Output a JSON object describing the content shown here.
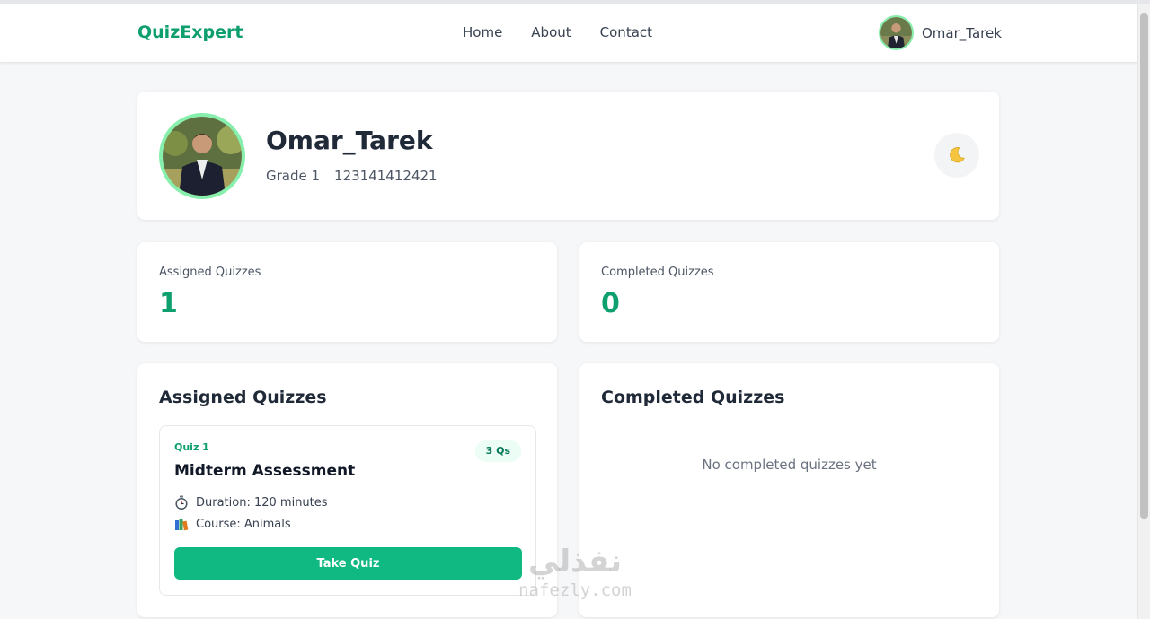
{
  "brand": "QuizExpert",
  "nav": {
    "links": [
      "Home",
      "About",
      "Contact"
    ],
    "username": "Omar_Tarek"
  },
  "profile": {
    "name": "Omar_Tarek",
    "grade": "Grade 1",
    "id_number": "123141412421",
    "theme_icon": "moon-icon"
  },
  "stats": [
    {
      "label": "Assigned Quizzes",
      "value": "1"
    },
    {
      "label": "Completed Quizzes",
      "value": "0"
    }
  ],
  "assigned": {
    "title": "Assigned Quizzes",
    "quizzes": [
      {
        "code": "Quiz 1",
        "badge": "3 Qs",
        "title": "Midterm Assessment",
        "duration_icon": "stopwatch-icon",
        "duration": "Duration: 120 minutes",
        "course_icon": "books-icon",
        "course": "Course: Animals",
        "button": "Take Quiz"
      }
    ]
  },
  "completed": {
    "title": "Completed Quizzes",
    "empty_message": "No completed quizzes yet"
  },
  "watermark": {
    "arabic": "نفذلي",
    "latin": "nafezly.com"
  },
  "colors": {
    "accent": "#0e9f6e",
    "button": "#10b981",
    "avatar_ring": "#86efac",
    "background": "#f6f7f9"
  }
}
